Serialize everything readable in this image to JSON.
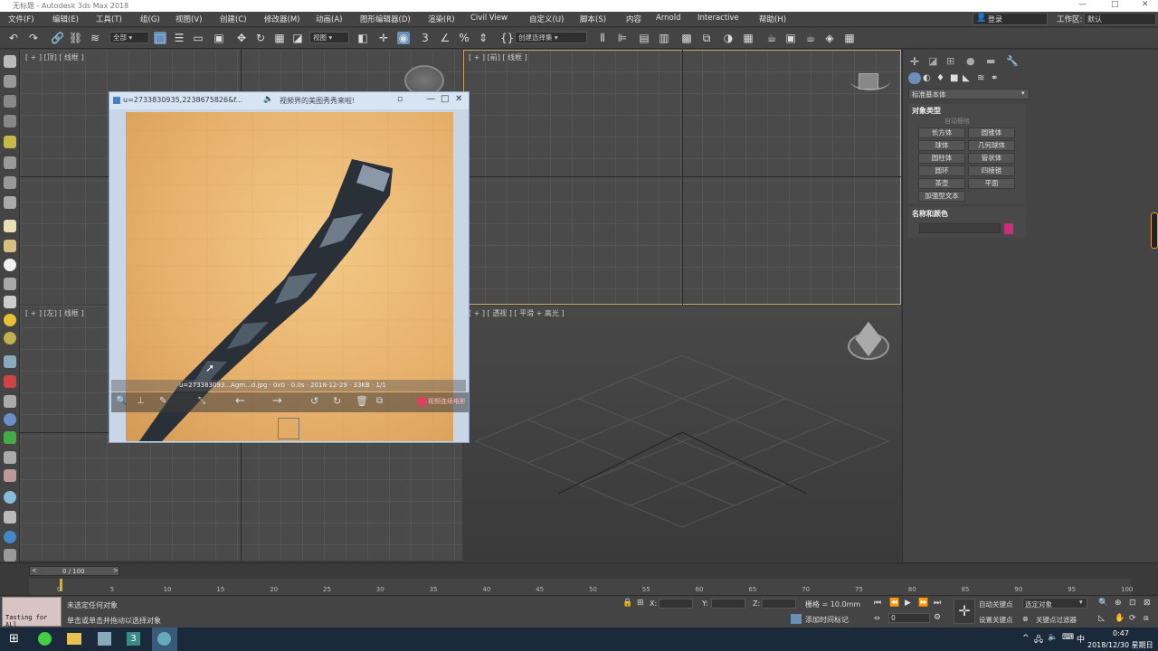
{
  "window": {
    "title": "无标题 - Autodesk 3ds Max 2018",
    "controls": [
      "—",
      "□",
      "✕"
    ]
  },
  "menu": [
    "文件(F)",
    "编辑(E)",
    "工具(T)",
    "组(G)",
    "视图(V)",
    "创建(C)",
    "修改器(M)",
    "动画(A)",
    "图形编辑器(D)",
    "渲染(R)",
    "Civil View",
    "自定义(U)",
    "脚本(S)",
    "内容",
    "Arnold",
    "Interactive",
    "帮助(H)"
  ],
  "menu_right": {
    "login": "登录",
    "workspace_label": "工作区:",
    "workspace_value": "默认"
  },
  "toolbar": {
    "filter_value": "全部",
    "view_value": "视图",
    "selection_set": "创建选择集"
  },
  "viewports": {
    "top": "[ + ] [顶] [ 线框 ]",
    "front": "[ + ] [前] [ 线框 ]",
    "left": "[ + ] [左] [ 线框 ]",
    "persp": "[ + ] [ 透视 ] [ 平滑 + 高光 ]"
  },
  "cmd_panel": {
    "category": "标准基本体",
    "object_type_header": "对象类型",
    "autogrid": "自动栅格",
    "buttons": [
      "长方体",
      "圆锥体",
      "球体",
      "几何球体",
      "圆柱体",
      "管状体",
      "圆环",
      "四棱锥",
      "茶壶",
      "平面",
      "加强型文本"
    ],
    "name_color_header": "名称和颜色",
    "color": "#c8307a"
  },
  "image_window": {
    "title": "u=2733830935,2238675826&f...",
    "notice": "视频界的美图秀秀来啦!",
    "info": "u=273383093...Agm...d.jpg · 0x0 · 0.0s · 2018-12-29 · 33KB · 1/1",
    "promo": "视频连续电影"
  },
  "timeline": {
    "frame": "0 / 100",
    "ticks": [
      "0",
      "5",
      "10",
      "15",
      "20",
      "25",
      "30",
      "35",
      "40",
      "45",
      "50",
      "55",
      "60",
      "65",
      "70",
      "75",
      "80",
      "85",
      "90",
      "95",
      "100"
    ]
  },
  "status": {
    "script_label": "Tasting for ALl",
    "msg1": "未选定任何对象",
    "msg2": "单击或单击并拖动以选择对象",
    "x_label": "X:",
    "y_label": "Y:",
    "z_label": "Z:",
    "grid_label": "栅格 = 10.0mm",
    "add_time_tag": "添加时间标记",
    "auto_key": "自动关键点",
    "selected_obj": "选定对象",
    "set_key": "设置关键点",
    "key_filter": "关键点过滤器",
    "frame_value": "0"
  },
  "taskbar": {
    "time": "0:47",
    "date": "2018/12/30 星期日",
    "ime": "中"
  }
}
